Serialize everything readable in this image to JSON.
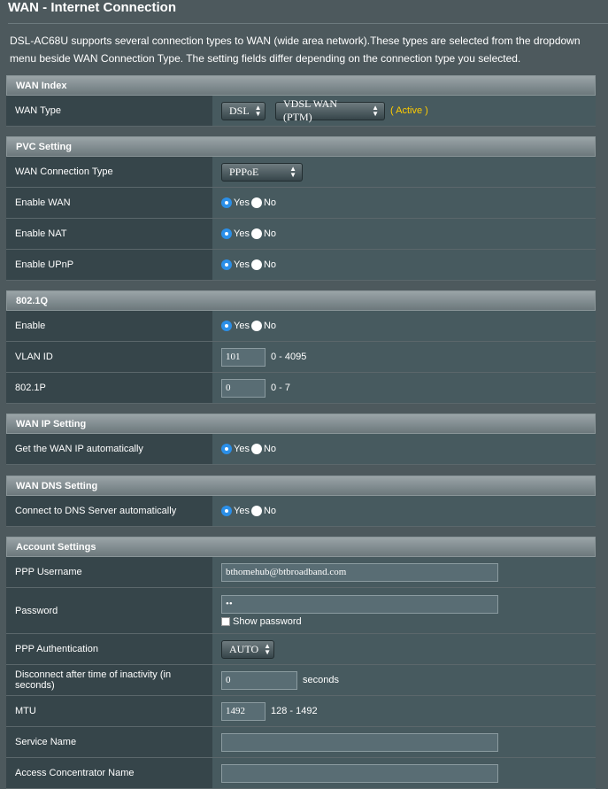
{
  "header": {
    "title": "WAN - Internet Connection"
  },
  "description": "DSL-AC68U supports several connection types to WAN (wide area network).These types are selected from the dropdown menu beside WAN Connection Type. The setting fields differ depending on the connection type you selected.",
  "wan_index": {
    "heading": "WAN Index",
    "wan_type_label": "WAN Type",
    "dsl_value": "DSL",
    "mode_value": "VDSL WAN (PTM)",
    "status": "( Active )"
  },
  "pvc": {
    "heading": "PVC Setting",
    "conn_type_label": "WAN Connection Type",
    "conn_type_value": "PPPoE",
    "enable_wan_label": "Enable WAN",
    "enable_nat_label": "Enable NAT",
    "enable_upnp_label": "Enable UPnP"
  },
  "vlan": {
    "heading": "802.1Q",
    "enable_label": "Enable",
    "vlan_id_label": "VLAN ID",
    "vlan_id_value": "101",
    "vlan_id_range": "0 - 4095",
    "p_label": "802.1P",
    "p_value": "0",
    "p_range": "0 - 7"
  },
  "wan_ip": {
    "heading": "WAN IP Setting",
    "auto_label": "Get the WAN IP automatically"
  },
  "wan_dns": {
    "heading": "WAN DNS Setting",
    "auto_label": "Connect to DNS Server automatically"
  },
  "account": {
    "heading": "Account Settings",
    "username_label": "PPP Username",
    "username_value": "bthomehub@btbroadband.com",
    "password_label": "Password",
    "password_value": "••",
    "show_password_label": "Show password",
    "auth_label": "PPP Authentication",
    "auth_value": "AUTO",
    "idle_label": "Disconnect after time of inactivity (in seconds)",
    "idle_value": "0",
    "idle_unit": "seconds",
    "mtu_label": "MTU",
    "mtu_value": "1492",
    "mtu_range": "128 - 1492",
    "service_label": "Service Name",
    "service_value": "",
    "ac_label": "Access Concentrator Name",
    "ac_value": ""
  },
  "radio": {
    "yes": "Yes",
    "no": "No"
  },
  "colors": {
    "active": "#ffcc00",
    "radio_on": "#2b8fe8"
  }
}
